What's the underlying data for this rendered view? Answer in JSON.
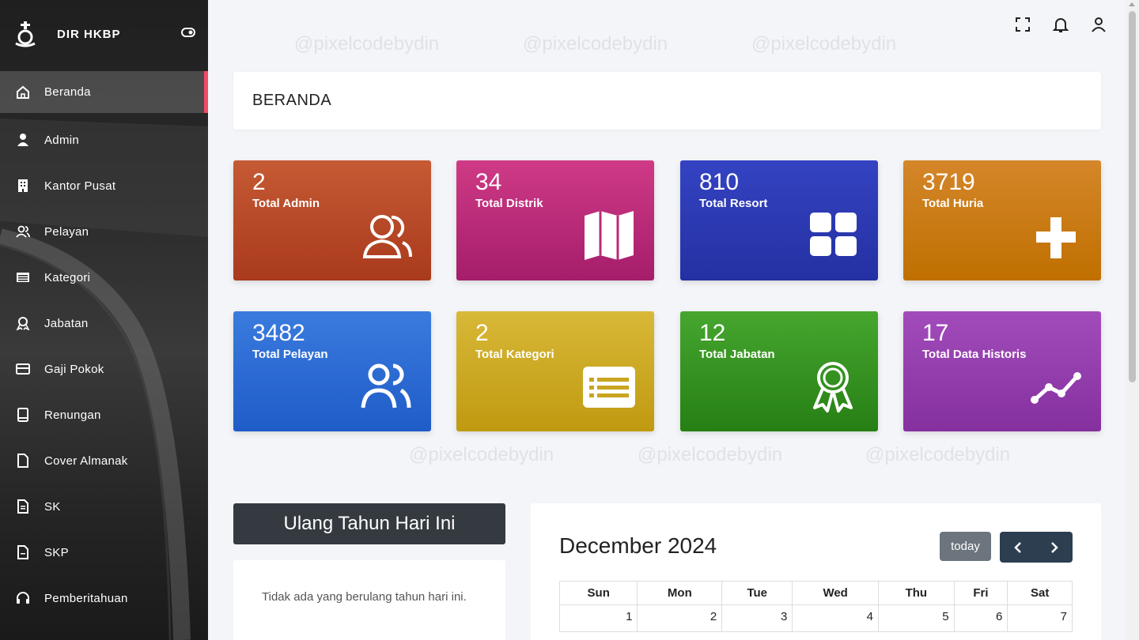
{
  "brand": {
    "name": "DIR HKBP"
  },
  "sidebar": {
    "items": [
      {
        "label": "Beranda",
        "icon": "home-icon"
      },
      {
        "label": "Admin",
        "icon": "user-icon"
      },
      {
        "label": "Kantor Pusat",
        "icon": "building-icon"
      },
      {
        "label": "Pelayan",
        "icon": "users-icon"
      },
      {
        "label": "Kategori",
        "icon": "list-icon"
      },
      {
        "label": "Jabatan",
        "icon": "award-icon"
      },
      {
        "label": "Gaji Pokok",
        "icon": "credit-card-icon"
      },
      {
        "label": "Renungan",
        "icon": "book-icon"
      },
      {
        "label": "Cover Almanak",
        "icon": "file-icon"
      },
      {
        "label": "SK",
        "icon": "file-text-icon"
      },
      {
        "label": "SKP",
        "icon": "file-icon"
      },
      {
        "label": "Pemberitahuan",
        "icon": "headset-icon"
      }
    ]
  },
  "header": {
    "title": "BERANDA"
  },
  "watermark": "@pixelcodebydin",
  "stats": [
    {
      "value": "2",
      "label": "Total Admin",
      "color": "#c0522e",
      "icon": "user-group-icon"
    },
    {
      "value": "34",
      "label": "Total Distrik",
      "color": "#c2317c",
      "icon": "map-icon"
    },
    {
      "value": "810",
      "label": "Total Resort",
      "color": "#2f3db5",
      "icon": "grid-icon"
    },
    {
      "value": "3719",
      "label": "Total Huria",
      "color": "#d07d12",
      "icon": "plus-icon"
    },
    {
      "value": "3482",
      "label": "Total Pelayan",
      "color": "#2f6fd8",
      "icon": "users-icon"
    },
    {
      "value": "2",
      "label": "Total Kategori",
      "color": "#cfaa24",
      "icon": "list-card-icon"
    },
    {
      "value": "12",
      "label": "Total Jabatan",
      "color": "#359a22",
      "icon": "award-icon"
    },
    {
      "value": "17",
      "label": "Total Data Historis",
      "color": "#9a3fb2",
      "icon": "trend-icon"
    }
  ],
  "birthday": {
    "title": "Ulang Tahun Hari Ini",
    "empty_text": "Tidak ada yang berulang tahun hari ini."
  },
  "calendar": {
    "title": "December 2024",
    "today_label": "today",
    "days": [
      "Sun",
      "Mon",
      "Tue",
      "Wed",
      "Thu",
      "Fri",
      "Sat"
    ],
    "week1": [
      "1",
      "2",
      "3",
      "4",
      "5",
      "6",
      "7"
    ]
  }
}
